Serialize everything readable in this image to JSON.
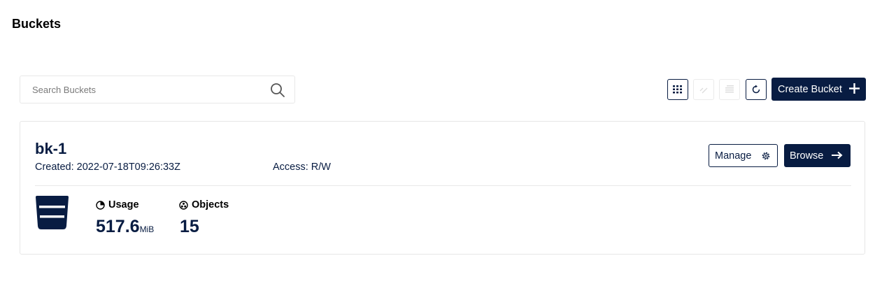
{
  "header": {
    "title": "Buckets"
  },
  "search": {
    "placeholder": "Search Buckets",
    "value": ""
  },
  "toolbar": {
    "buttons": [
      {
        "name": "list-view",
        "icon": "grid-icon",
        "state": "active"
      },
      {
        "name": "replication",
        "icon": "replicate-icon",
        "state": "disabled"
      },
      {
        "name": "bulk-delete",
        "icon": "multi-select-icon",
        "state": "disabled"
      },
      {
        "name": "refresh",
        "icon": "refresh-icon",
        "state": "enabled"
      }
    ],
    "create_label": "Create Bucket",
    "create_icon": "plus-icon"
  },
  "buckets": [
    {
      "name": "bk-1",
      "created": "Created: 2022-07-18T09:26:33Z",
      "access": "Access: R/W",
      "manage_label": "Manage",
      "browse_label": "Browse",
      "usage_label": "Usage",
      "usage_value": "517.6",
      "usage_unit": "MiB",
      "objects_label": "Objects",
      "objects_value": "15"
    }
  ],
  "colors": {
    "accent": "#081c42",
    "border": "#e6e6e6",
    "background": "#ffffff"
  }
}
